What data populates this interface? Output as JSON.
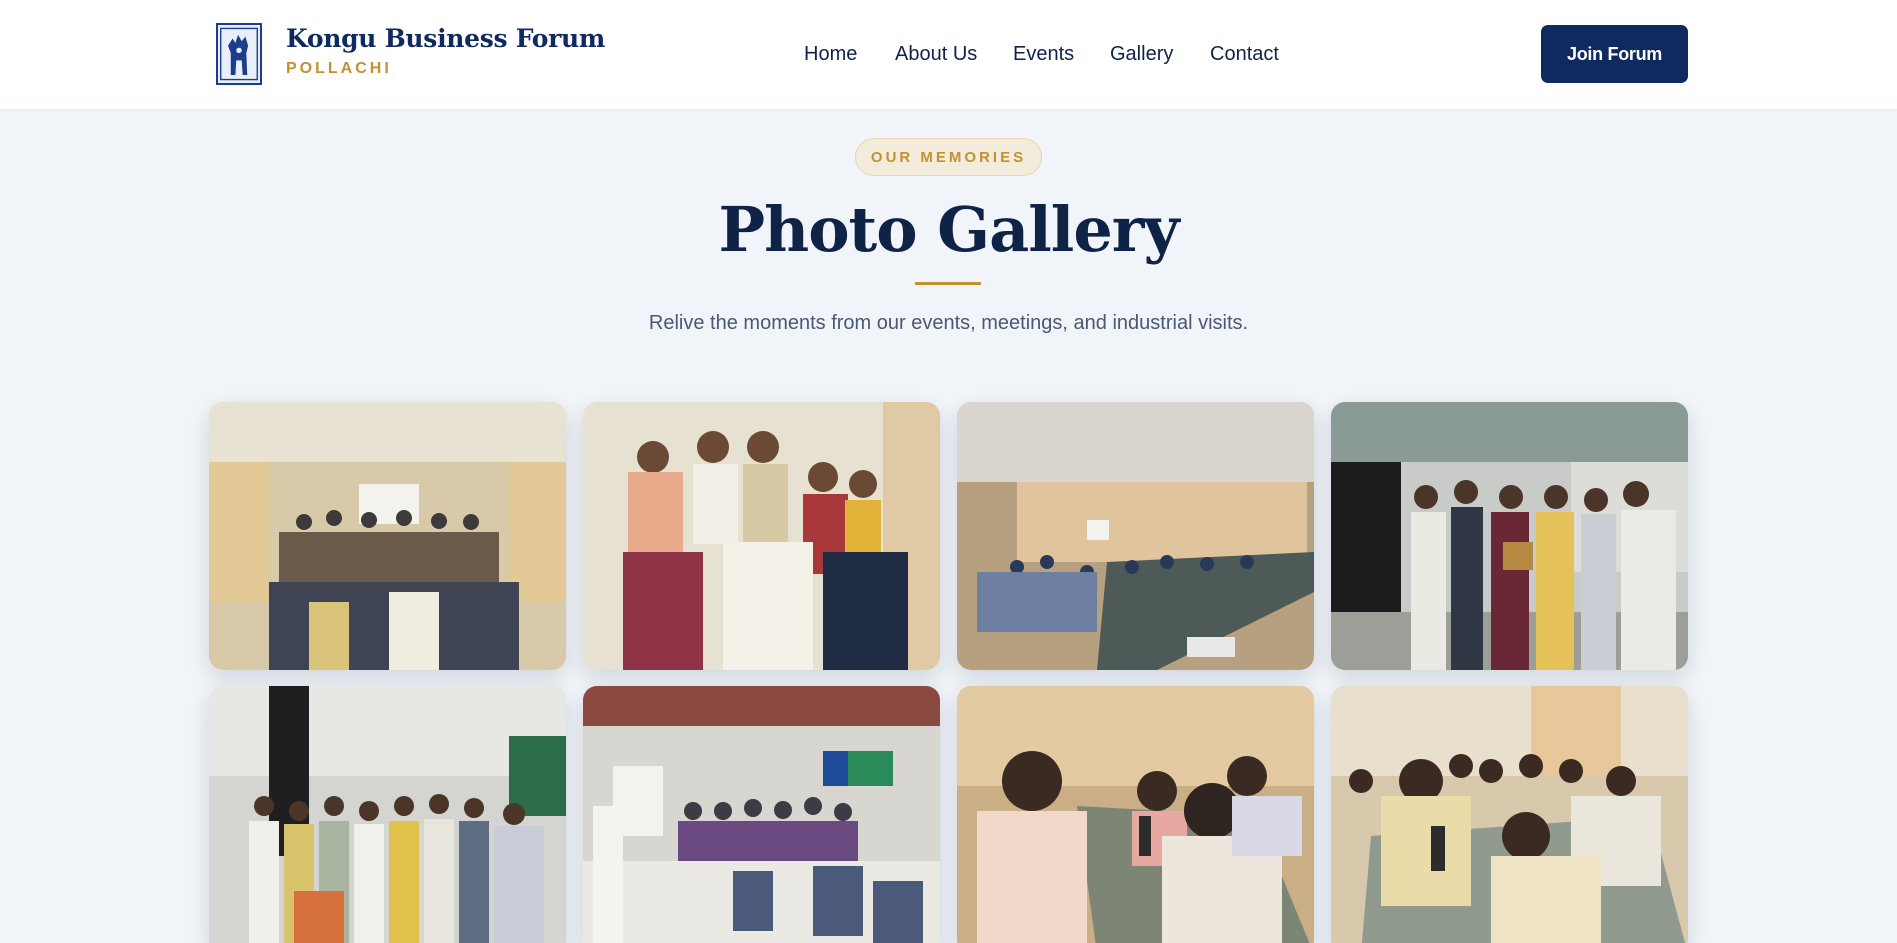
{
  "header": {
    "logo_icon": "forum-emblem-icon",
    "brand_title": "Kongu Business Forum",
    "brand_subtitle": "POLLACHI",
    "nav": [
      {
        "label": "Home"
      },
      {
        "label": "About Us"
      },
      {
        "label": "Events"
      },
      {
        "label": "Gallery"
      },
      {
        "label": "Contact"
      }
    ],
    "cta_label": "Join Forum"
  },
  "section": {
    "eyebrow": "OUR MEMORIES",
    "title": "Photo Gallery",
    "subtitle": "Relive the moments from our events, meetings, and industrial visits."
  },
  "gallery": {
    "photos": [
      {
        "subject": "group photo in hall"
      },
      {
        "subject": "members group portrait"
      },
      {
        "subject": "conference room meeting"
      },
      {
        "subject": "award presentation at factory"
      },
      {
        "subject": "certificate distribution at factory"
      },
      {
        "subject": "seminar audience in hall"
      },
      {
        "subject": "discussion at meeting table"
      },
      {
        "subject": "round table networking"
      }
    ]
  },
  "colors": {
    "navy": "#0f2a5e",
    "gold": "#c2922e",
    "background": "#f1f4f8"
  }
}
